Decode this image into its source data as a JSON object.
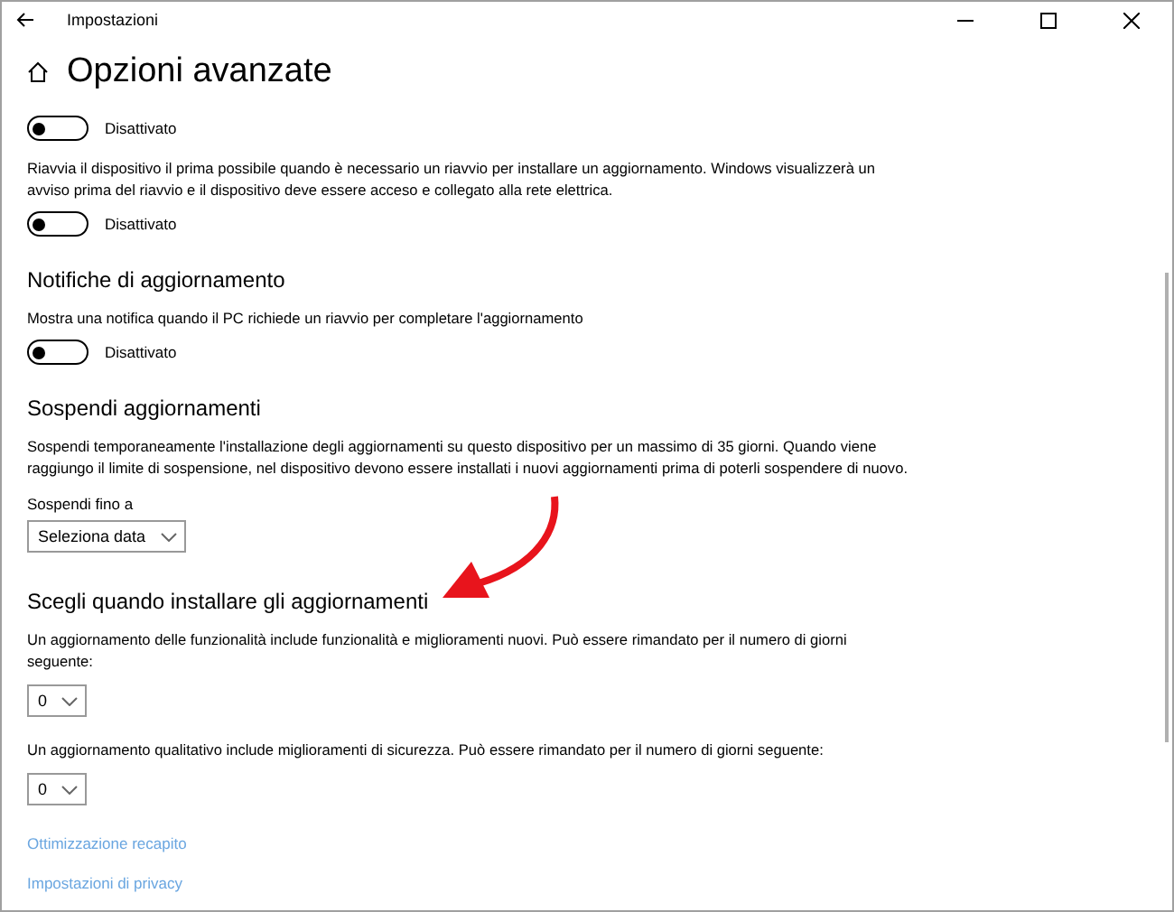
{
  "window": {
    "title": "Impostazioni"
  },
  "page": {
    "title": "Opzioni avanzate"
  },
  "blocks": [
    {
      "kind": "toggle",
      "on": false,
      "label": "Disattivato"
    },
    {
      "kind": "text",
      "text": "Riavvia il dispositivo il prima possibile quando è necessario un riavvio per installare un aggiornamento. Windows visualizzerà un avviso prima del riavvio e il dispositivo deve essere acceso e collegato alla rete elettrica."
    },
    {
      "kind": "toggle",
      "on": false,
      "label": "Disattivato"
    },
    {
      "kind": "heading",
      "text": "Notifiche di aggiornamento"
    },
    {
      "kind": "text",
      "text": "Mostra una notifica quando il PC richiede un riavvio per completare l'aggiornamento"
    },
    {
      "kind": "toggle",
      "on": false,
      "label": "Disattivato"
    },
    {
      "kind": "heading",
      "text": "Sospendi aggiornamenti"
    },
    {
      "kind": "text",
      "text": "Sospendi temporaneamente l'installazione degli aggiornamenti su questo dispositivo per un massimo di 35 giorni. Quando viene raggiungo il limite di sospensione, nel dispositivo devono essere installati i nuovi aggiornamenti prima di poterli sospendere di nuovo."
    },
    {
      "kind": "label",
      "text": "Sospendi fino a"
    },
    {
      "kind": "dropdown",
      "value": "Seleziona data"
    },
    {
      "kind": "heading",
      "text": "Scegli quando installare gli aggiornamenti"
    },
    {
      "kind": "text",
      "text": "Un aggiornamento delle funzionalità include funzionalità e miglioramenti nuovi. Può essere rimandato per il numero di giorni seguente:"
    },
    {
      "kind": "dropdown",
      "value": "0"
    },
    {
      "kind": "text",
      "text": "Un aggiornamento qualitativo include miglioramenti di sicurezza. Può essere rimandato per il numero di giorni seguente:"
    },
    {
      "kind": "dropdown",
      "value": "0"
    },
    {
      "kind": "link",
      "text": "Ottimizzazione recapito"
    },
    {
      "kind": "link",
      "text": "Impostazioni di privacy"
    }
  ]
}
